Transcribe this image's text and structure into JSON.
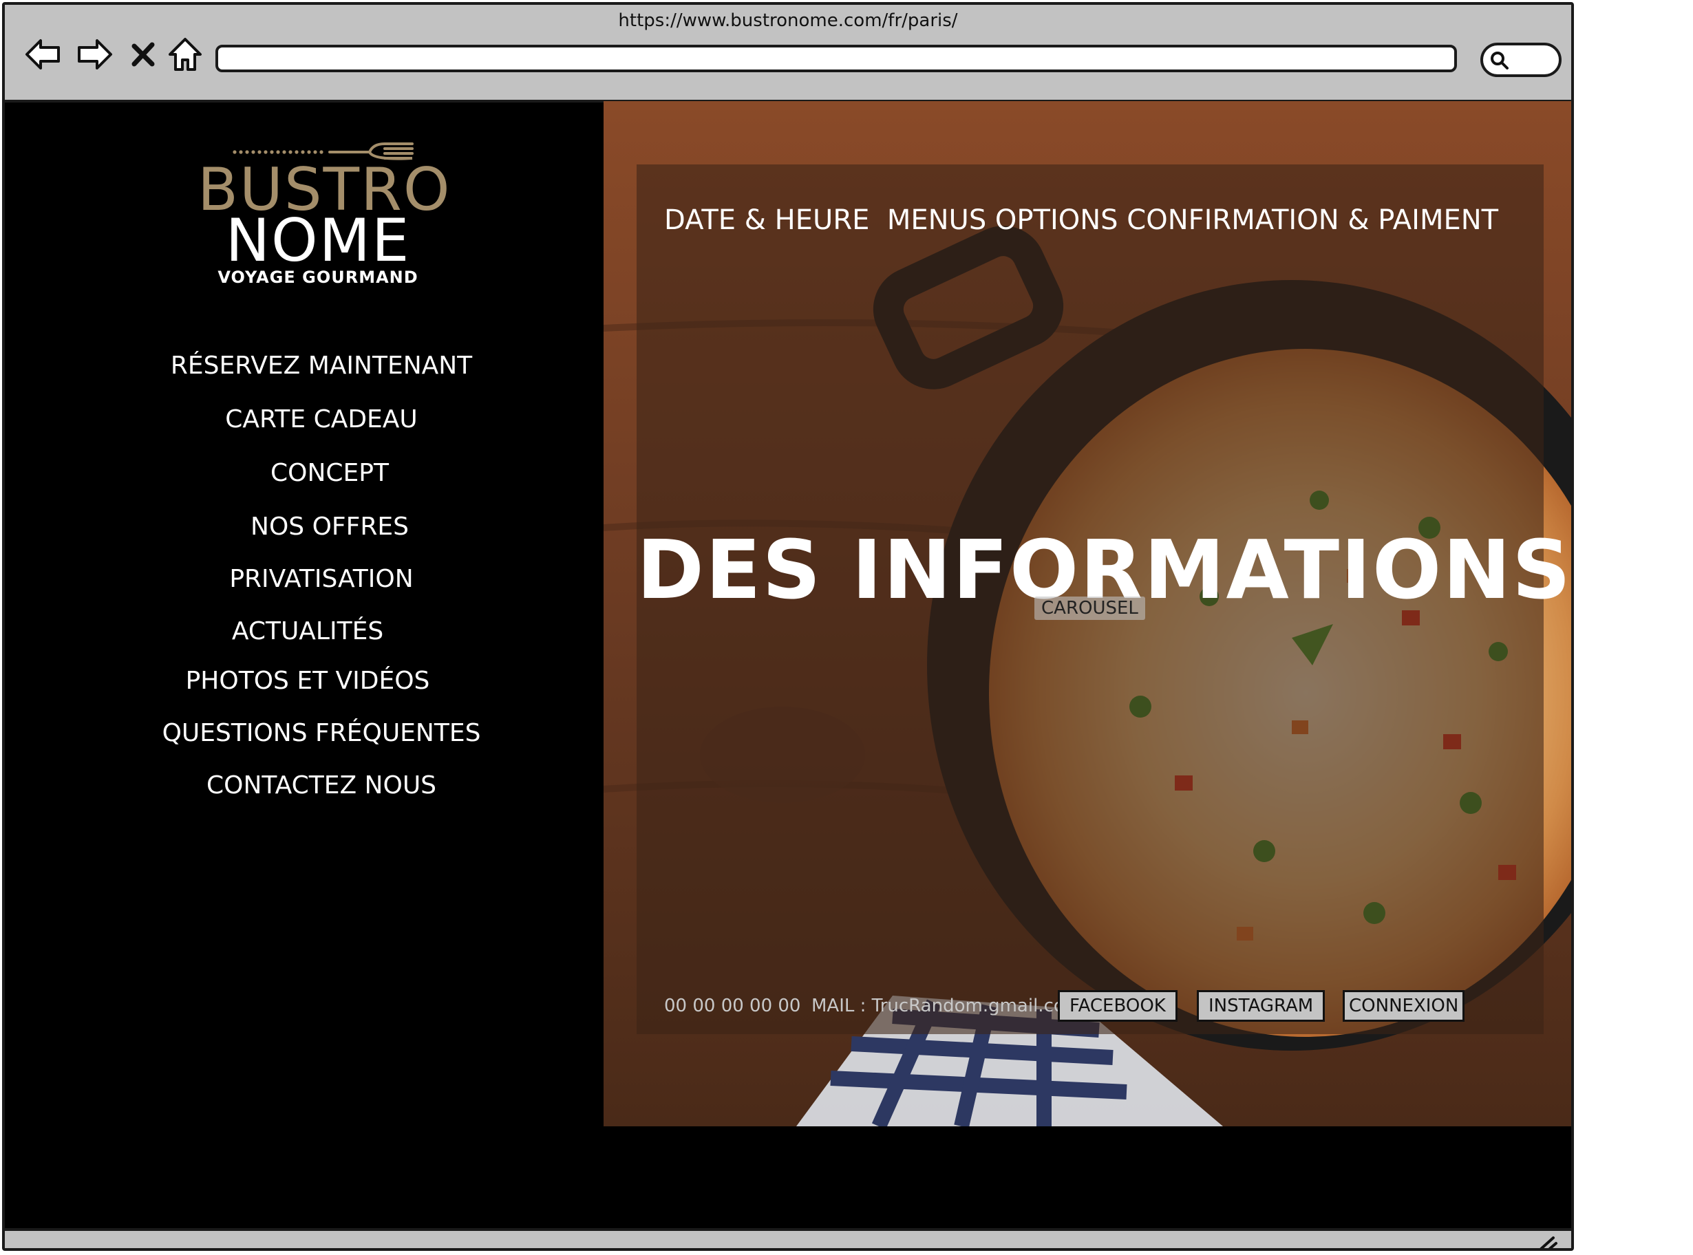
{
  "browser": {
    "url": "https://www.bustronome.com/fr/paris/",
    "icons": [
      "back-arrow-icon",
      "forward-arrow-icon",
      "close-icon",
      "home-icon",
      "search-icon",
      "resize-grip-icon"
    ]
  },
  "logo": {
    "line1": "BUSTRO",
    "line2": "NOME",
    "tagline": "VOYAGE GOURMAND",
    "colors": {
      "gold": "#a48e6a",
      "white": "#ffffff"
    }
  },
  "sidebar": {
    "items": [
      {
        "label": "RÉSERVEZ MAINTENANT"
      },
      {
        "label": "CARTE CADEAU"
      },
      {
        "label": "CONCEPT"
      },
      {
        "label": "NOS OFFRES"
      },
      {
        "label": "PRIVATISATION"
      },
      {
        "label": "ACTUALITÉS"
      },
      {
        "label": "PHOTOS ET VIDÉOS"
      },
      {
        "label": "QUESTIONS FRÉQUENTES"
      },
      {
        "label": "CONTACTEZ NOUS"
      }
    ]
  },
  "steps": {
    "date": "DATE & HEURE",
    "menus": "MENUS",
    "options": "OPTIONS",
    "confirmation": "CONFIRMATION & PAIMENT"
  },
  "hero": {
    "title": "DES INFORMATIONS",
    "carousel_label": "CAROUSEL"
  },
  "footer": {
    "phone": "00 00 00 00 00",
    "mail": "MAIL : TrucRandom.gmail.com",
    "facebook": "FACEBOOK",
    "instagram": "INSTAGRAM",
    "login": "CONNEXION"
  }
}
